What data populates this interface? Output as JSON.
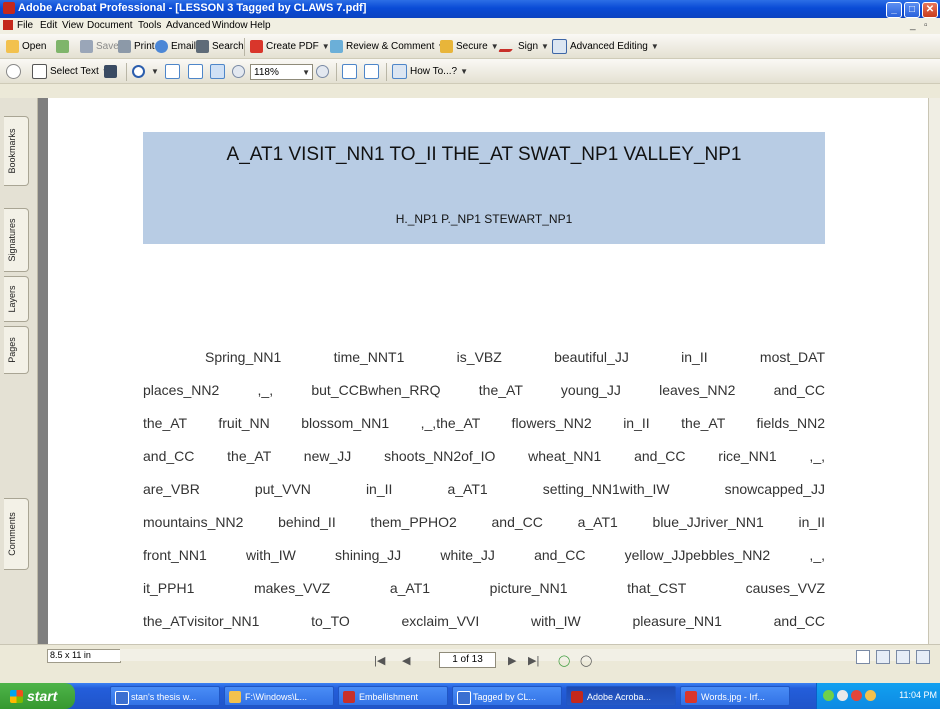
{
  "window": {
    "title": "Adobe Acrobat Professional - [LESSON 3 Tagged by CLAWS 7.pdf]"
  },
  "menu": [
    "File",
    "Edit",
    "View",
    "Document",
    "Tools",
    "Advanced",
    "Window",
    "Help"
  ],
  "toolbar1": {
    "open": "Open",
    "save": "Save",
    "print": "Print",
    "email": "Email",
    "search": "Search",
    "create_pdf": "Create PDF",
    "review_comment": "Review & Comment",
    "secure": "Secure",
    "sign": "Sign",
    "advanced_editing": "Advanced Editing"
  },
  "toolbar2": {
    "select_text": "Select Text",
    "zoom": "118%",
    "how_to": "How To...?"
  },
  "nav_tabs": [
    "Bookmarks",
    "Signatures",
    "Layers",
    "Pages",
    "Comments"
  ],
  "document": {
    "title": "A_AT1 VISIT_NN1 TO_II THE_AT SWAT_NP1 VALLEY_NP1",
    "author": "H._NP1 P._NP1 STEWART_NP1",
    "lines": [
      "Spring_NN1 time_NNT1 is_VBZ beautiful_JJ in_II most_DAT",
      "places_NN2 ,_, but_CCBwhen_RRQ the_AT young_JJ leaves_NN2 and_CC",
      "the_AT fruit_NN blossom_NN1 ,_,the_AT flowers_NN2 in_II the_AT fields_NN2",
      "and_CC the_AT new_JJ shoots_NN2of_IO wheat_NN1 and_CC rice_NN1 ,_,",
      "are_VBR put_VVN in_II a_AT1 setting_NN1with_IW snowcapped_JJ",
      "mountains_NN2 behind_II them_PPHO2 and_CC a_AT1 blue_JJriver_NN1 in_II",
      "front_NN1 with_IW shining_JJ white_JJ and_CC yellow_JJpebbles_NN2 ,_,",
      "it_PPH1 makes_VVZ a_AT1 picture_NN1 that_CST causes_VVZ",
      "the_ATvisitor_NN1 to_TO exclaim_VVI with_IW pleasure_NN1 and_CC"
    ]
  },
  "status": {
    "page_size": "8.5 x 11 in",
    "page_counter": "1 of 13"
  },
  "taskbar": {
    "start": "start",
    "tasks": [
      "stan's thesis w...",
      "F:\\Windows\\L...",
      "Embellishment",
      "Tagged by CL...",
      "Adobe Acroba...",
      "Words.jpg - Irf..."
    ],
    "clock": "11:04 PM"
  }
}
